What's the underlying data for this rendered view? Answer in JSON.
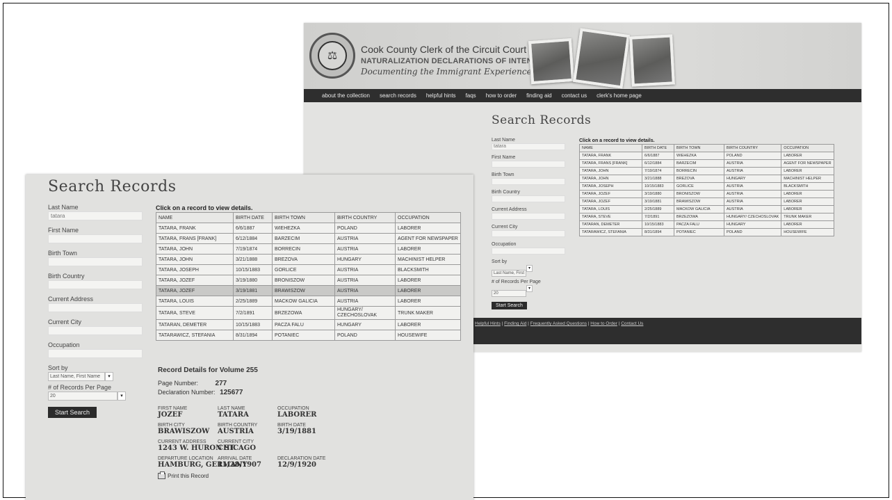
{
  "back": {
    "banner": {
      "title": "Cook County Clerk of the Circuit Court",
      "subtitle": "NATURALIZATION DECLARATIONS OF INTENTION",
      "tagline": "Documenting the Immigrant Experience"
    },
    "nav": [
      "about the collection",
      "search records",
      "helpful hints",
      "faqs",
      "how to order",
      "finding aid",
      "contact us",
      "clerk's home page"
    ],
    "heading": "Search Records",
    "form": {
      "last_name_label": "Last Name",
      "last_name_value": "tatara",
      "first_name_label": "First Name",
      "birth_town_label": "Birth Town",
      "birth_country_label": "Birth Country",
      "current_address_label": "Current Address",
      "current_city_label": "Current City",
      "occupation_label": "Occupation",
      "sort_by_label": "Sort by",
      "sort_by_value": "Last Name, First Name",
      "per_page_label": "# of Records Per Page",
      "per_page_value": "20",
      "search_button": "Start Search"
    },
    "table_caption": "Click on a record to view details.",
    "table_headers": [
      "NAME",
      "BIRTH DATE",
      "BIRTH TOWN",
      "BIRTH COUNTRY",
      "OCCUPATION"
    ],
    "footer_links": [
      "Helpful Hints",
      "Finding Aid",
      "Frequently Asked Questions",
      "How to Order",
      "Contact Us"
    ]
  },
  "front": {
    "heading": "Search Records",
    "form": {
      "last_name_label": "Last Name",
      "last_name_value": "tatara",
      "first_name_label": "First Name",
      "birth_town_label": "Birth Town",
      "birth_country_label": "Birth Country",
      "current_address_label": "Current Address",
      "current_city_label": "Current City",
      "occupation_label": "Occupation",
      "sort_by_label": "Sort by",
      "sort_by_value": "Last Name, First Name",
      "per_page_label": "# of Records Per Page",
      "per_page_value": "20",
      "search_button": "Start Search"
    },
    "table_caption": "Click on a record to view details.",
    "table_headers": [
      "NAME",
      "BIRTH DATE",
      "BIRTH TOWN",
      "BIRTH COUNTRY",
      "OCCUPATION"
    ],
    "details": {
      "title": "Record Details for Volume 255",
      "page_label": "Page Number:",
      "page_value": "277",
      "decl_label": "Declaration Number:",
      "decl_value": "125677",
      "fields": [
        {
          "k": "FIRST NAME",
          "v": "JOZEF"
        },
        {
          "k": "LAST NAME",
          "v": "TATARA"
        },
        {
          "k": "OCCUPATION",
          "v": "LABORER"
        },
        {
          "k": "BIRTH CITY",
          "v": "BRAWISZOW"
        },
        {
          "k": "BIRTH COUNTRY",
          "v": "AUSTRIA"
        },
        {
          "k": "BIRTH DATE",
          "v": "3/19/1881"
        },
        {
          "k": "CURRENT ADDRESS",
          "v": "1243 W. HURON ST."
        },
        {
          "k": "CURRENT CITY",
          "v": "CHICAGO"
        },
        {
          "k": "",
          "v": ""
        },
        {
          "k": "DEPARTURE LOCATION",
          "v": "HAMBURG, GERMANY"
        },
        {
          "k": "ARRIVAL DATE",
          "v": "11/28/1907"
        },
        {
          "k": "DECLARATION DATE",
          "v": "12/9/1920"
        }
      ],
      "print_label": "Print this Record"
    }
  },
  "records": [
    {
      "name": "TATARA, FRANK",
      "birth_date": "6/6/1887",
      "birth_town": "WIEHEZKA",
      "birth_country": "POLAND",
      "occupation": "LABORER"
    },
    {
      "name": "TATARA, FRANS [FRANK]",
      "birth_date": "6/12/1884",
      "birth_town": "BARZECIM",
      "birth_country": "AUSTRIA",
      "occupation": "AGENT FOR NEWSPAPER"
    },
    {
      "name": "TATARA, JOHN",
      "birth_date": "7/19/1874",
      "birth_town": "BORRECIN",
      "birth_country": "AUSTRIA",
      "occupation": "LABORER"
    },
    {
      "name": "TATARA, JOHN",
      "birth_date": "3/21/1888",
      "birth_town": "BREZOVA",
      "birth_country": "HUNGARY",
      "occupation": "MACHINIST HELPER"
    },
    {
      "name": "TATARA, JOSEPH",
      "birth_date": "10/15/1883",
      "birth_town": "GORLICE",
      "birth_country": "AUSTRIA",
      "occupation": "BLACKSMITH"
    },
    {
      "name": "TATARA, JOZEF",
      "birth_date": "3/19/1880",
      "birth_town": "BRONISZOW",
      "birth_country": "AUSTRIA",
      "occupation": "LABORER"
    },
    {
      "name": "TATARA, JOZEF",
      "birth_date": "3/19/1881",
      "birth_town": "BRAWISZOW",
      "birth_country": "AUSTRIA",
      "occupation": "LABORER"
    },
    {
      "name": "TATARA, LOUIS",
      "birth_date": "2/25/1889",
      "birth_town": "MACKOW GALICIA",
      "birth_country": "AUSTRIA",
      "occupation": "LABORER"
    },
    {
      "name": "TATARA, STEVE",
      "birth_date": "7/2/1891",
      "birth_town": "BRZEZOWA",
      "birth_country": "HUNGARY/ CZECHOSLOVAK",
      "occupation": "TRUNK MAKER"
    },
    {
      "name": "TATARAN, DEMETER",
      "birth_date": "10/15/1883",
      "birth_town": "PACZA FALU",
      "birth_country": "HUNGARY",
      "occupation": "LABORER"
    },
    {
      "name": "TATARAWICZ, STEFANIA",
      "birth_date": "8/31/1894",
      "birth_town": "POTANIEC",
      "birth_country": "POLAND",
      "occupation": "HOUSEWIFE"
    }
  ],
  "selected_record_index": 6
}
